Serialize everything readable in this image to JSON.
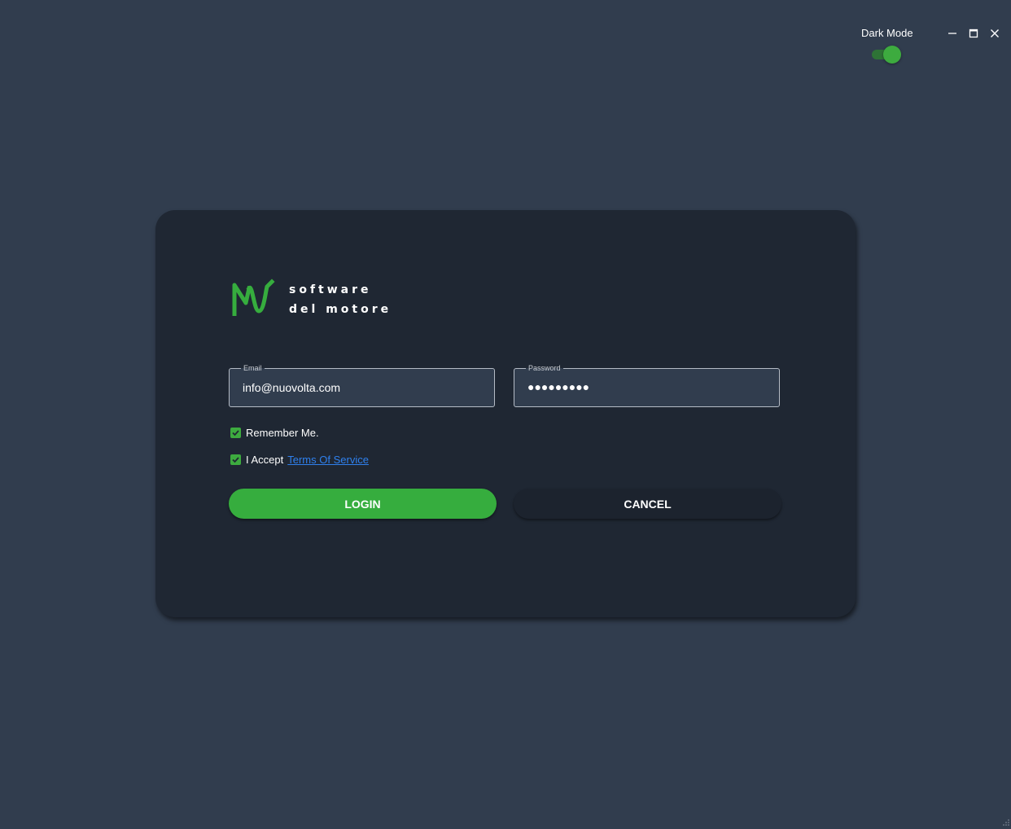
{
  "header": {
    "dark_mode_label": "Dark Mode",
    "dark_mode_on": true
  },
  "window_controls": {
    "minimize_icon": "minimize-icon",
    "maximize_icon": "maximize-icon",
    "close_icon": "close-icon"
  },
  "logo": {
    "mark_icon": "nv-logo-mark",
    "line1": "software",
    "line2": "del motore"
  },
  "form": {
    "email": {
      "label": "Email",
      "value": "info@nuovolta.com"
    },
    "password": {
      "label": "Password",
      "masked_value": "●●●●●●●●●"
    },
    "remember_me": {
      "label": "Remember Me.",
      "checked": true
    },
    "accept_terms": {
      "label": "I Accept",
      "link_text": "Terms Of Service",
      "checked": true
    },
    "login_label": "LOGIN",
    "cancel_label": "CANCEL"
  },
  "colors": {
    "background": "#313d4e",
    "card": "#1f2733",
    "accent_green": "#36ad3e",
    "link_blue": "#2f80ed"
  }
}
